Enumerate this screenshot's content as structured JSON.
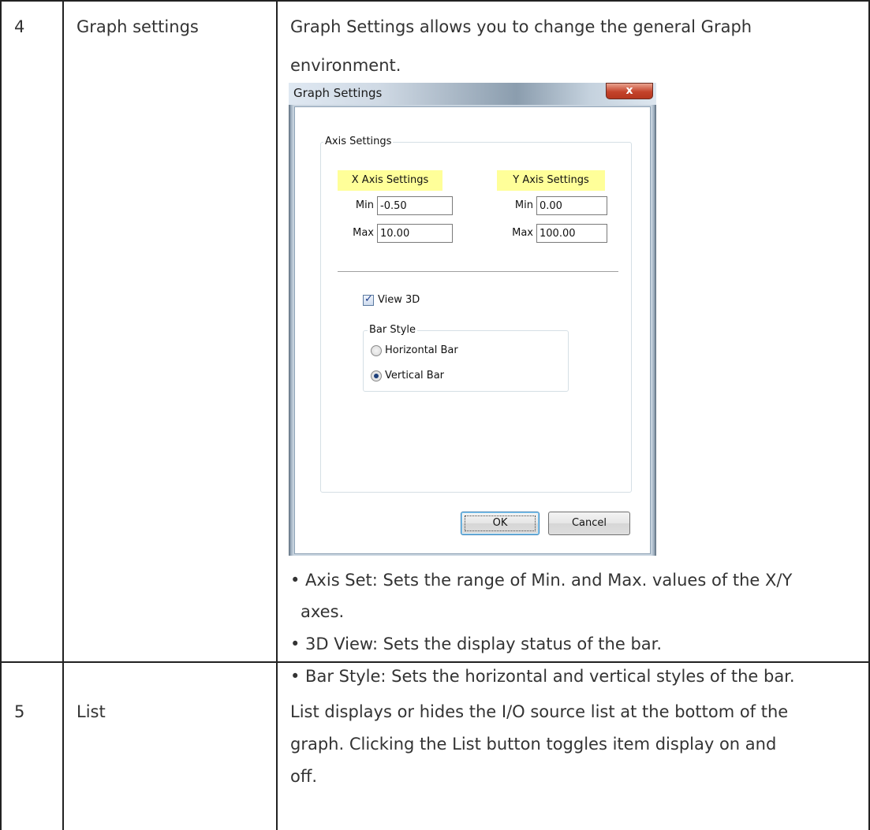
{
  "rows": [
    {
      "number": "4",
      "name": "Graph settings",
      "description_lines": [
        "Graph Settings allows you to change the general Graph",
        "environment."
      ],
      "bullets": [
        {
          "lines": [
            "• Axis Set: Sets the range of Min. and Max. values of the X/Y",
            "axes."
          ]
        },
        {
          "lines": [
            "• 3D View: Sets the display status of the bar."
          ]
        },
        {
          "lines": [
            "• Bar Style: Sets the horizontal and vertical styles of the bar."
          ]
        }
      ]
    },
    {
      "number": "5",
      "name": "List",
      "description_lines": [
        "List displays or hides the I/O source list at the bottom of the",
        "graph. Clicking the List button toggles item display on and",
        "off."
      ]
    }
  ],
  "dialog": {
    "title": "Graph Settings",
    "close_glyph": "x",
    "axis_group_label": "Axis Settings",
    "x_axis": {
      "heading": "X Axis Settings",
      "min_label": "Min",
      "min_value": "-0.50",
      "max_label": "Max",
      "max_value": "10.00"
    },
    "y_axis": {
      "heading": "Y Axis Settings",
      "min_label": "Min",
      "min_value": "0.00",
      "max_label": "Max",
      "max_value": "100.00"
    },
    "view3d": {
      "label": "View 3D",
      "checked": true,
      "check_glyph": "✓"
    },
    "bar_style": {
      "label": "Bar Style",
      "options": [
        "Horizontal Bar",
        "Vertical Bar"
      ],
      "selected": "Vertical Bar"
    },
    "ok_label": "OK",
    "cancel_label": "Cancel"
  },
  "colors": {
    "grid_line": "#222222",
    "text": "#333333",
    "axis_heading_bg": "#ffff99",
    "close_button": "#c4432b"
  }
}
